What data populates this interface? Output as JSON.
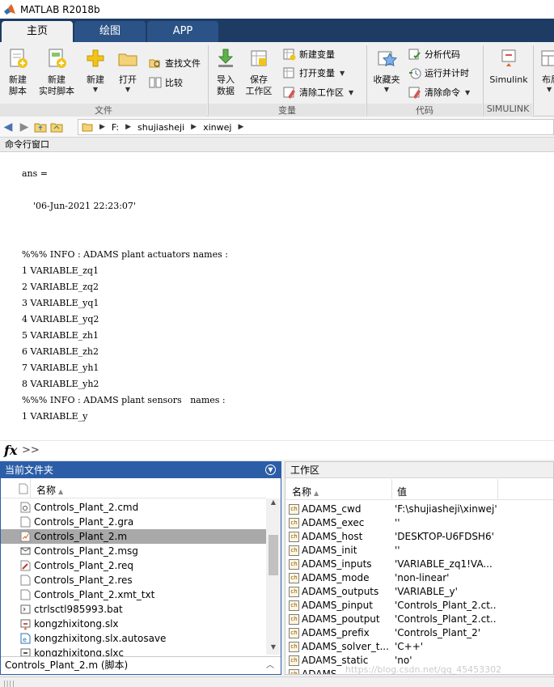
{
  "window": {
    "title": "MATLAB R2018b"
  },
  "tabs": [
    {
      "label": "主页",
      "active": true
    },
    {
      "label": "绘图",
      "active": false
    },
    {
      "label": "APP",
      "active": false
    }
  ],
  "ribbon": {
    "file": {
      "section_label": "文件",
      "new_script": "新建\n脚本",
      "new_live_script": "新建\n实时脚本",
      "new": "新建",
      "open": "打开",
      "find_files": "查找文件",
      "compare": "比较"
    },
    "variable": {
      "section_label": "变量",
      "import_data": "导入\n数据",
      "save_workspace": "保存\n工作区",
      "new_variable": "新建变量",
      "open_variable": "打开变量",
      "clear_workspace": "清除工作区"
    },
    "code": {
      "section_label": "代码",
      "favorites": "收藏夹",
      "analyze_code": "分析代码",
      "run_and_time": "运行并计时",
      "clear_commands": "清除命令"
    },
    "simulink": {
      "section_label": "SIMULINK",
      "simulink": "Simulink"
    },
    "layout": {
      "label": "布局"
    }
  },
  "address": {
    "path": [
      "F:",
      "shujiasheji",
      "xinwej"
    ]
  },
  "command_window": {
    "header": "命令行窗口",
    "lines": [
      "ans =",
      "",
      "    '06-Jun-2021 22:23:07'",
      "",
      "",
      "%%% INFO : ADAMS plant actuators names :",
      "1 VARIABLE_zq1",
      "2 VARIABLE_zq2",
      "3 VARIABLE_yq1",
      "4 VARIABLE_yq2",
      "5 VARIABLE_zh1",
      "6 VARIABLE_zh2",
      "7 VARIABLE_yh1",
      "8 VARIABLE_yh2",
      "%%% INFO : ADAMS plant sensors   names :",
      "1 VARIABLE_y"
    ],
    "fx_label": "fx",
    "prompt": ">>"
  },
  "current_folder": {
    "title": "当前文件夹",
    "column_name": "名称",
    "files": [
      {
        "name": "Controls_Plant_2.cmd",
        "icon": "cmd-file-icon",
        "selected": false
      },
      {
        "name": "Controls_Plant_2.gra",
        "icon": "generic-file-icon",
        "selected": false
      },
      {
        "name": "Controls_Plant_2.m",
        "icon": "m-file-icon",
        "selected": true
      },
      {
        "name": "Controls_Plant_2.msg",
        "icon": "mail-file-icon",
        "selected": false
      },
      {
        "name": "Controls_Plant_2.req",
        "icon": "req-file-icon",
        "selected": false
      },
      {
        "name": "Controls_Plant_2.res",
        "icon": "generic-file-icon",
        "selected": false
      },
      {
        "name": "Controls_Plant_2.xmt_txt",
        "icon": "generic-file-icon",
        "selected": false
      },
      {
        "name": "ctrlsctl985993.bat",
        "icon": "bat-file-icon",
        "selected": false
      },
      {
        "name": "kongzhixitong.slx",
        "icon": "slx-file-icon",
        "selected": false
      },
      {
        "name": "kongzhixitong.slx.autosave",
        "icon": "autosave-file-icon",
        "selected": false
      },
      {
        "name": "kongzhixitong.slxc",
        "icon": "slxc-file-icon",
        "selected": false
      }
    ],
    "status": "Controls_Plant_2.m  (脚本)"
  },
  "workspace": {
    "title": "工作区",
    "column_name": "名称",
    "column_value": "值",
    "variables": [
      {
        "name": "ADAMS_cwd",
        "value": "'F:\\shujiasheji\\xinwej'"
      },
      {
        "name": "ADAMS_exec",
        "value": "''"
      },
      {
        "name": "ADAMS_host",
        "value": "'DESKTOP-U6FDSH6'"
      },
      {
        "name": "ADAMS_init",
        "value": "''"
      },
      {
        "name": "ADAMS_inputs",
        "value": "'VARIABLE_zq1!VA..."
      },
      {
        "name": "ADAMS_mode",
        "value": "'non-linear'"
      },
      {
        "name": "ADAMS_outputs",
        "value": "'VARIABLE_y'"
      },
      {
        "name": "ADAMS_pinput",
        "value": "'Controls_Plant_2.ct..."
      },
      {
        "name": "ADAMS_poutput",
        "value": "'Controls_Plant_2.ct..."
      },
      {
        "name": "ADAMS_prefix",
        "value": "'Controls_Plant_2'"
      },
      {
        "name": "ADAMS_solver_t...",
        "value": "'C++'"
      },
      {
        "name": "ADAMS_static",
        "value": "'no'"
      },
      {
        "name": "ADAMS_...",
        "value": ""
      }
    ]
  },
  "watermark": "https://blog.csdn.net/qq_45453302",
  "colors": {
    "tab_bar": "#1d3b63",
    "tab_inactive": "#2c5387",
    "panel_focus": "#2c5ea8",
    "selected_row": "#a9a9a9"
  }
}
